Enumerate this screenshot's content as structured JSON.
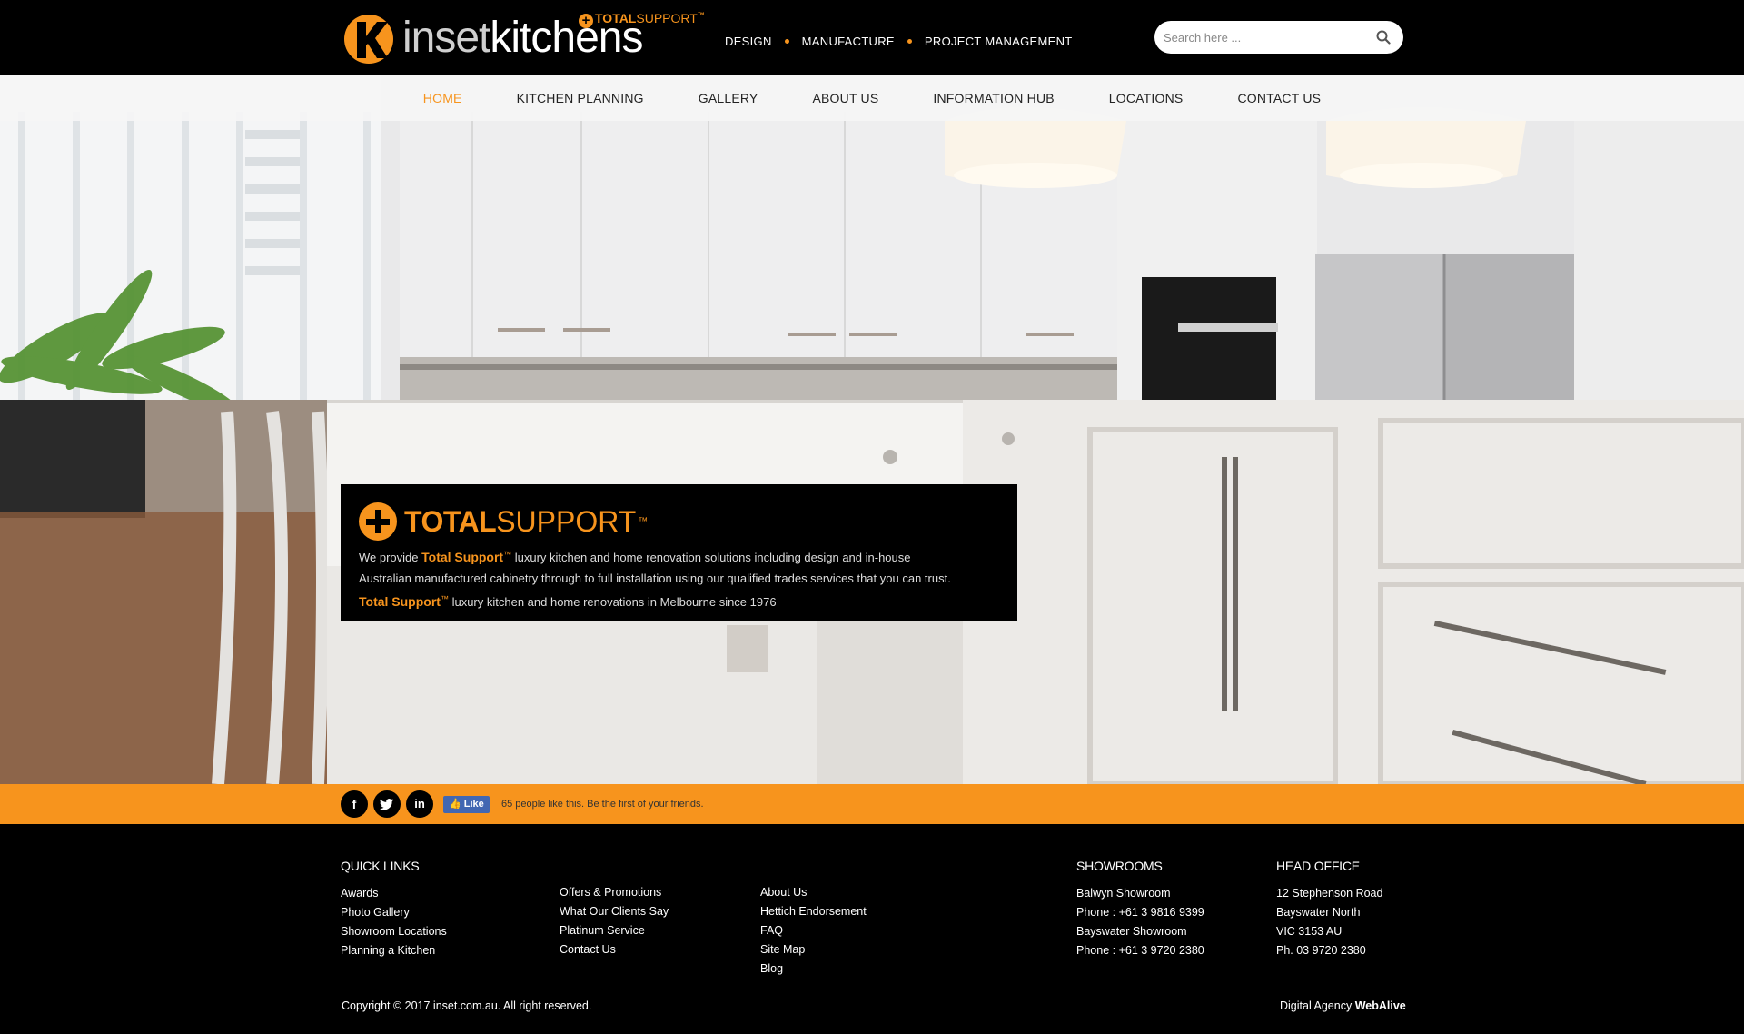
{
  "brand": {
    "logo_text_inset": "inset",
    "logo_text_kitchens": "kitchens",
    "logo_total": "TOTAL",
    "logo_support": "SUPPORT",
    "logo_tm": "™",
    "accent_color": "#f7941d"
  },
  "tagline": {
    "items": [
      "DESIGN",
      "MANUFACTURE",
      "PROJECT MANAGEMENT"
    ]
  },
  "search": {
    "placeholder": "Search here ...",
    "value": "",
    "icon": "search-icon"
  },
  "nav": {
    "items": [
      {
        "label": "HOME",
        "active": true
      },
      {
        "label": "KITCHEN PLANNING",
        "active": false
      },
      {
        "label": "GALLERY",
        "active": false
      },
      {
        "label": "ABOUT US",
        "active": false
      },
      {
        "label": "INFORMATION HUB",
        "active": false
      },
      {
        "label": "LOCATIONS",
        "active": false
      },
      {
        "label": "CONTACT US",
        "active": false
      }
    ]
  },
  "infobox": {
    "logo_total": "TOTAL",
    "logo_support": "SUPPORT",
    "logo_tm": "™",
    "line1_prefix": "We provide",
    "highlight": "Total Support",
    "tm": "™",
    "line1_suffix": "luxury kitchen and home renovation solutions including design and in-house",
    "line2": "Australian manufactured cabinetry through to full installation using our qualified trades services that you can trust.",
    "line3_suffix": "luxury kitchen and home renovations in Melbourne since 1976"
  },
  "social": {
    "icons": [
      "facebook-icon",
      "twitter-icon",
      "linkedin-icon"
    ],
    "like_label": "Like",
    "like_text": "65 people like this. Be the first of your friends."
  },
  "footer": {
    "quick_links_heading": "QUICK LINKS",
    "col1": [
      "Awards",
      "Photo Gallery",
      "Showroom Locations",
      "Planning a Kitchen"
    ],
    "col2": [
      "Offers & Promotions",
      "What Our Clients Say",
      "Platinum Service",
      "Contact Us"
    ],
    "col3": [
      "About Us",
      "Hettich Endorsement",
      "FAQ",
      "Site Map",
      "Blog"
    ],
    "showrooms_heading": "SHOWROOMS",
    "showrooms": [
      "Balwyn Showroom",
      "Phone : +61 3 9816 9399",
      "Bayswater Showroom",
      "Phone : +61 3 9720 2380"
    ],
    "head_office_heading": "HEAD OFFICE",
    "head_office": [
      "12 Stephenson Road",
      "Bayswater North",
      "VIC 3153 AU",
      "Ph. 03 9720 2380"
    ],
    "copyright": "Copyright © 2017 inset.com.au. All right reserved.",
    "agency_prefix": "Digital Agency",
    "agency_name": "WebAlive"
  }
}
